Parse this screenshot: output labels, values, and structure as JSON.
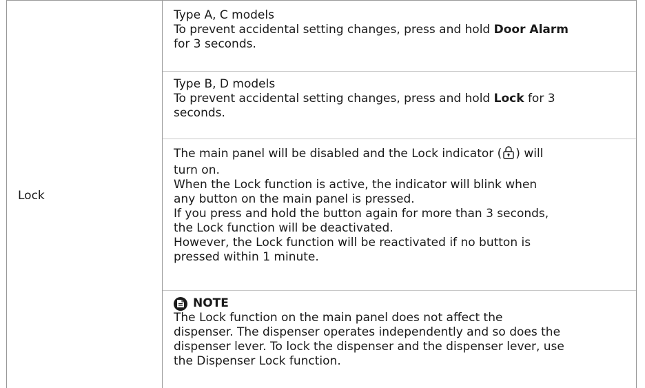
{
  "row_label": "Lock",
  "sections": {
    "type_ac": {
      "heading": "Type A, C models",
      "text_before": "To prevent accidental setting changes, press and hold ",
      "bold": "Door Alarm",
      "text_after": "for 3 seconds."
    },
    "type_bd": {
      "heading": "Type B, D models",
      "text_before": "To prevent accidental setting changes, press and hold ",
      "bold": "Lock",
      "text_after_line1": " for 3",
      "text_after_line2": "seconds."
    },
    "body": {
      "p1_before": "The main panel will be disabled and the Lock indicator (",
      "p1_after": ") will",
      "p1_line2": "turn on.",
      "p2_line1": "When the Lock function is active, the indicator will blink when",
      "p2_line2": "any button on the main panel is pressed.",
      "p3_line1": "If you press and hold the button again for more than 3 seconds,",
      "p3_line2": "the Lock function will be deactivated.",
      "p4_line1": "However, the Lock function will be reactivated if no button is",
      "p4_line2": "pressed within 1 minute."
    },
    "note": {
      "icon": "note-icon",
      "heading": "NOTE",
      "line1": "The Lock function on the main panel does not affect the",
      "line2": "dispenser. The dispenser operates independently and so does the",
      "line3": "dispenser lever. To lock the dispenser and the dispenser lever, use",
      "line4": "the Dispenser Lock function."
    }
  },
  "lock_indicator_icon": "padlock-icon"
}
